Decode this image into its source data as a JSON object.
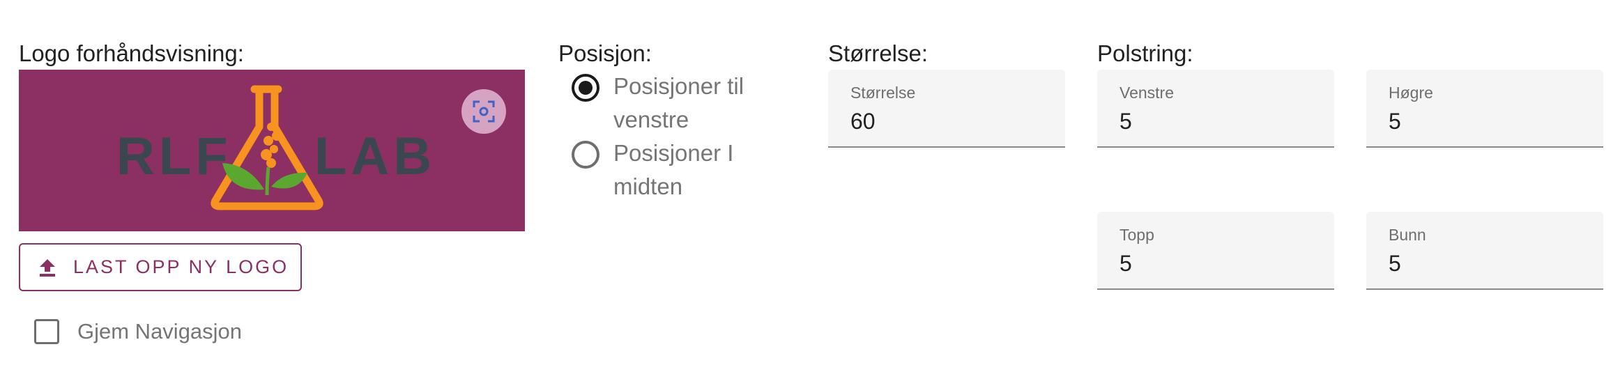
{
  "logo_section": {
    "label": "Logo forhåndsvisning:",
    "logo_text_left": "RLF",
    "logo_text_right": "LAB",
    "upload_button_label": "LAST OPP NY LOGO",
    "hide_navigation_label": "Gjem Navigasjon",
    "hide_navigation_checked": false
  },
  "position_section": {
    "label": "Posisjon:",
    "options": [
      {
        "label": "Posisjoner til venstre",
        "checked": true
      },
      {
        "label": "Posisjoner I midten",
        "checked": false
      }
    ]
  },
  "size_section": {
    "label": "Størrelse:",
    "field": {
      "label": "Størrelse",
      "value": "60"
    }
  },
  "padding_section": {
    "label": "Polstring:",
    "left": {
      "label": "Venstre",
      "value": "5"
    },
    "right": {
      "label": "Høgre",
      "value": "5"
    },
    "top": {
      "label": "Topp",
      "value": "5"
    },
    "bottom": {
      "label": "Bunn",
      "value": "5"
    }
  },
  "colors": {
    "brand": "#8c2f62",
    "logo_orange": "#f7931e",
    "logo_green": "#5aa830",
    "logo_text": "#3a4750"
  },
  "icons": {
    "crop": "crop-focus-icon",
    "upload": "upload-icon"
  }
}
